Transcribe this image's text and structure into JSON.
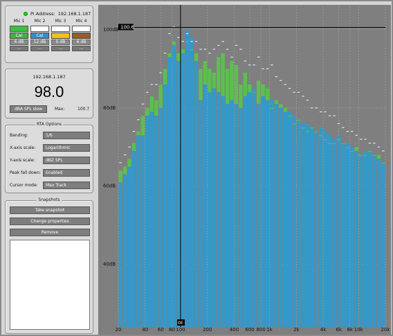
{
  "header": {
    "pi_label": "Pi Address:",
    "pi_address": "192.168.1.187"
  },
  "mics": [
    {
      "name": "Mic 1",
      "color": "#3fbf3f",
      "button": "Cal",
      "button_color": "#3cb43c",
      "gain": "6 dB",
      "more": "..."
    },
    {
      "name": "Mic 2",
      "color": "#ffffff",
      "button": "Cal",
      "button_color": "#2f8fd0",
      "gain": "12 dB",
      "more": "..."
    },
    {
      "name": "Mic 3",
      "color": "#ffffff",
      "button": "",
      "button_color": "#f2c21a",
      "gain": "0 dB",
      "more": "..."
    },
    {
      "name": "Mic 4",
      "color": "#ffffff",
      "button": "",
      "button_color": "#9c5a2c",
      "gain": "6 dB",
      "more": "..."
    }
  ],
  "reading": {
    "ip": "192.168.1.187",
    "value": "98.0",
    "mode_button": "dBA SPL slow",
    "max_label": "Max:",
    "max_value": "100.7"
  },
  "rta_options": {
    "title": "RTA Options",
    "rows": [
      {
        "label": "Banding:",
        "value": "1/6"
      },
      {
        "label": "X-axis scale:",
        "value": "Logarithmic"
      },
      {
        "label": "Y-axis scale:",
        "value": "dBZ SPL"
      },
      {
        "label": "Peak fall down:",
        "value": "Enabled"
      },
      {
        "label": "Cursor mode:",
        "value": "Max Track"
      }
    ]
  },
  "snapshots": {
    "title": "Snapshots",
    "buttons": [
      "Take snapshot",
      "Change properties",
      "Remove"
    ]
  },
  "chart_data": {
    "type": "bar",
    "x_scale": "log",
    "xlim": [
      20,
      20000
    ],
    "ylim": [
      24,
      106
    ],
    "x_ticks": [
      {
        "v": 20,
        "label": "20"
      },
      {
        "v": 40,
        "label": "40"
      },
      {
        "v": 60,
        "label": "60"
      },
      {
        "v": 80,
        "label": "80"
      },
      {
        "v": 100,
        "label": "100"
      },
      {
        "v": 200,
        "label": "200"
      },
      {
        "v": 400,
        "label": "400"
      },
      {
        "v": 600,
        "label": "600"
      },
      {
        "v": 800,
        "label": "800"
      },
      {
        "v": 1000,
        "label": "1k"
      },
      {
        "v": 2000,
        "label": "2k"
      },
      {
        "v": 4000,
        "label": "4k"
      },
      {
        "v": 6000,
        "label": "6k"
      },
      {
        "v": 8000,
        "label": "8k"
      },
      {
        "v": 10000,
        "label": "10k"
      },
      {
        "v": 20000,
        "label": "20k"
      }
    ],
    "y_ticks": [
      {
        "v": 40,
        "label": "40dB"
      },
      {
        "v": 60,
        "label": "60dB"
      },
      {
        "v": 80,
        "label": "80dB"
      },
      {
        "v": 100,
        "label": "100dB"
      }
    ],
    "cursor": {
      "freq": 100,
      "freq_label": "0E",
      "level": 100.6,
      "level_label": "100.6"
    },
    "colors": {
      "blue": "#3399cc",
      "green": "#5cbf4f",
      "peak": "#dfe6f0",
      "background": "#7f7f7f"
    },
    "series": [
      {
        "name": "blue",
        "values": [
          61,
          63,
          65,
          69,
          73,
          73,
          78,
          79,
          78,
          80,
          86,
          93,
          96,
          92,
          94,
          100,
          98,
          92,
          82,
          86,
          84,
          85,
          84,
          83,
          81,
          82,
          81,
          80,
          83,
          84,
          85,
          81,
          83,
          82,
          82,
          81,
          80,
          79,
          79,
          78,
          77,
          76,
          76,
          75,
          74,
          75,
          74,
          73,
          72,
          73,
          71,
          71,
          70,
          69,
          68,
          69,
          69,
          68,
          67,
          66
        ]
      },
      {
        "name": "green",
        "values": [
          64,
          65,
          67,
          71,
          74,
          78,
          80,
          83,
          82,
          86,
          90,
          94,
          97,
          94,
          95,
          97,
          95,
          94,
          90,
          92,
          90,
          89,
          93,
          94,
          90,
          92,
          91,
          86,
          89,
          86,
          84,
          87,
          86,
          85,
          80,
          82,
          81,
          80,
          78,
          76,
          77,
          75,
          74,
          75,
          74,
          73,
          72,
          71,
          71,
          72,
          71,
          70,
          69,
          70,
          68,
          68,
          69,
          68,
          68,
          66
        ]
      },
      {
        "name": "peak",
        "values": [
          66,
          68,
          70,
          74,
          77,
          81,
          84,
          86,
          86,
          89,
          94,
          99,
          100.7,
          98,
          97,
          99,
          97,
          97,
          95,
          95,
          94,
          95,
          96,
          97,
          95,
          93,
          96,
          95,
          92,
          91,
          91,
          93,
          90,
          90,
          91,
          88,
          87,
          86,
          85,
          84,
          84,
          83,
          82,
          80,
          80,
          79,
          79,
          78,
          78,
          76,
          75,
          74,
          74,
          73,
          72,
          72,
          71,
          71,
          70,
          69
        ]
      }
    ]
  }
}
